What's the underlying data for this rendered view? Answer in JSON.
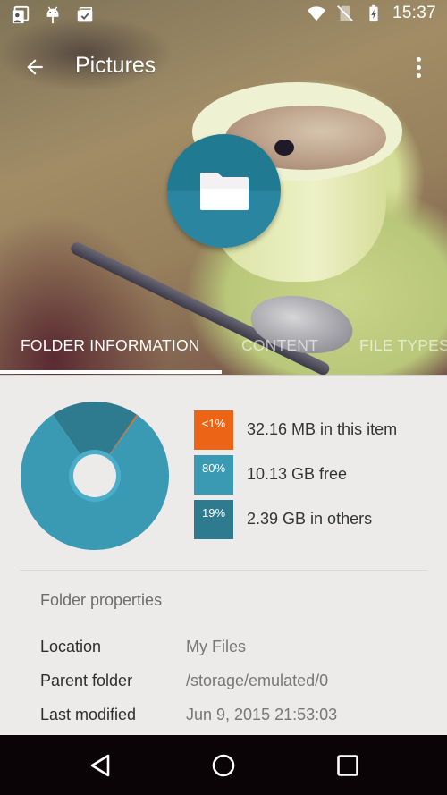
{
  "status_bar": {
    "left_icons": [
      "image-sync-icon",
      "android-debug-icon",
      "clipboard-check-icon"
    ],
    "right_icons": [
      "wifi-icon",
      "no-sim-icon",
      "battery-charging-icon"
    ],
    "time": "15:37"
  },
  "toolbar": {
    "title": "Pictures",
    "back_icon": "arrow-back-icon",
    "overflow_icon": "more-vert-icon"
  },
  "fab": {
    "icon": "folder-icon"
  },
  "tabs": [
    {
      "label": "FOLDER INFORMATION",
      "active": true
    },
    {
      "label": "CONTENT",
      "active": false
    },
    {
      "label": "FILE TYPES",
      "active": false
    }
  ],
  "storage": {
    "legend": [
      {
        "percent": "<1%",
        "text": "32.16 MB in this item",
        "color": "#ec6517"
      },
      {
        "percent": "80%",
        "text": "10.13 GB free",
        "color": "#3a99b3"
      },
      {
        "percent": "19%",
        "text": "2.39 GB in others",
        "color": "#2e7a8f"
      }
    ]
  },
  "chart_data": {
    "type": "pie",
    "variant": "donut",
    "categories": [
      "This item",
      "Free",
      "Others"
    ],
    "values": [
      0.3,
      80,
      19
    ],
    "labels": [
      "<1%",
      "80%",
      "19%"
    ],
    "colors": [
      "#ec6517",
      "#3a99b3",
      "#2e7a8f"
    ],
    "center_ring_color": "#4aaecb"
  },
  "properties": {
    "section_title": "Folder properties",
    "rows": [
      {
        "label": "Location",
        "value": "My Files"
      },
      {
        "label": "Parent folder",
        "value": "/storage/emulated/0"
      },
      {
        "label": "Last modified",
        "value": "Jun 9, 2015 21:53:03"
      }
    ]
  },
  "nav_bar": {
    "buttons": [
      "back-nav-icon",
      "home-nav-icon",
      "recents-nav-icon"
    ]
  }
}
